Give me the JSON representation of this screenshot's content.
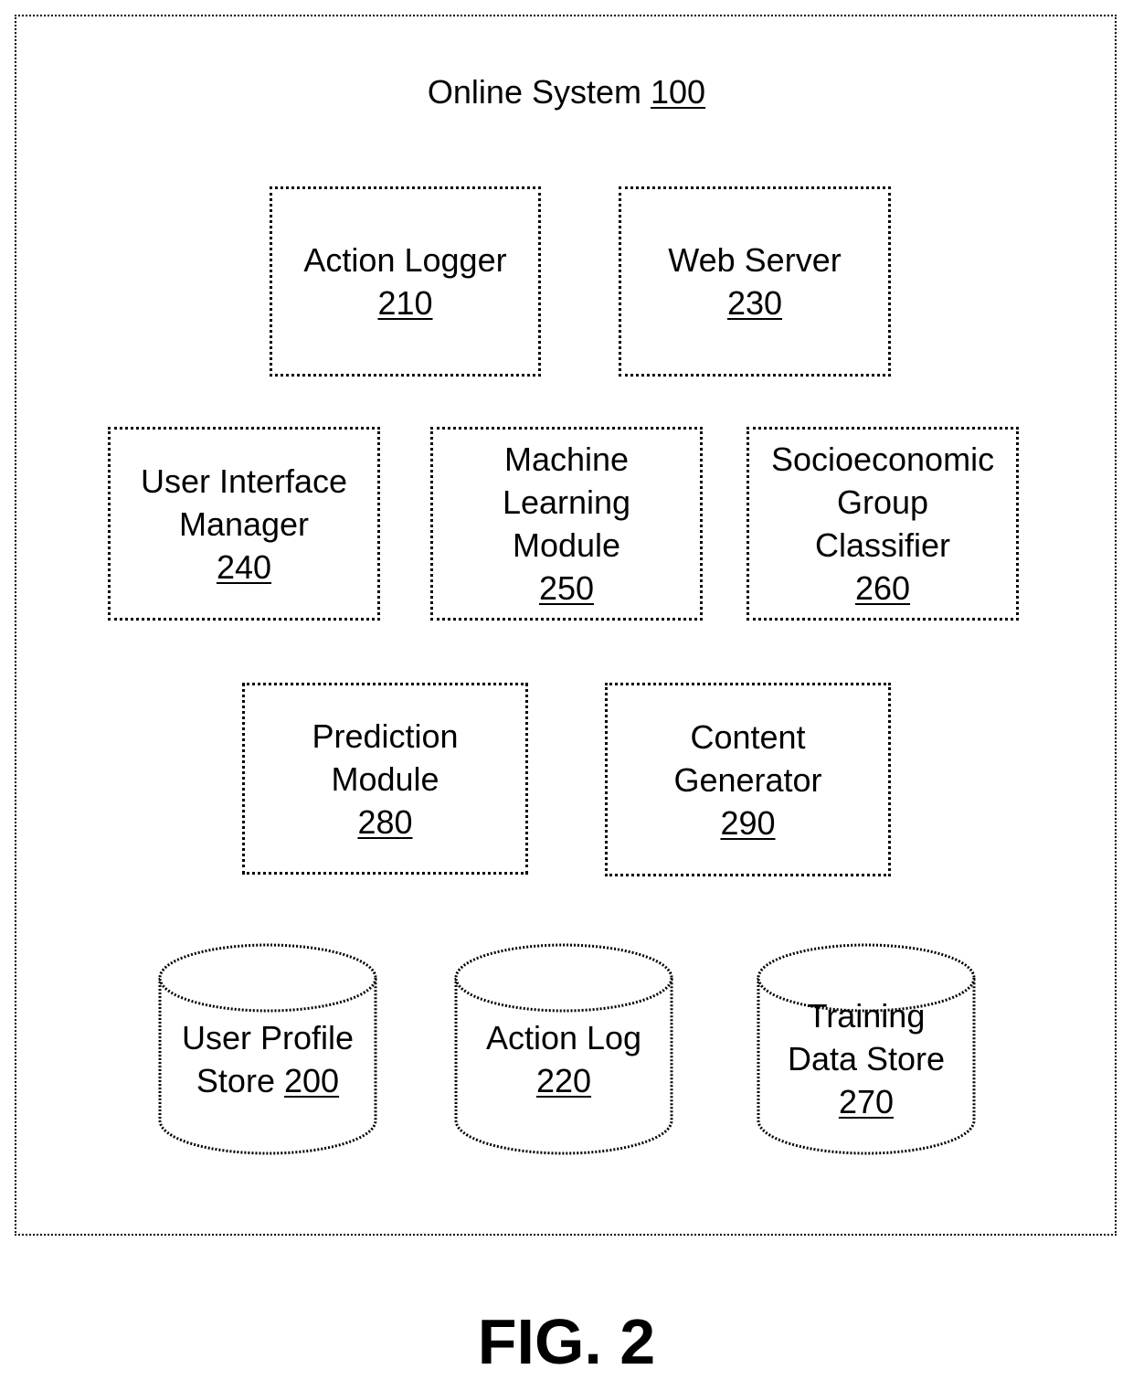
{
  "diagram": {
    "system": {
      "label": "Online System",
      "ref": "100"
    },
    "modules": [
      {
        "id": "action-logger",
        "lines": [
          "Action Logger"
        ],
        "ref": "210"
      },
      {
        "id": "web-server",
        "lines": [
          "Web Server"
        ],
        "ref": "230"
      },
      {
        "id": "user-interface-manager",
        "lines": [
          "User Interface",
          "Manager"
        ],
        "ref": "240"
      },
      {
        "id": "machine-learning-module",
        "lines": [
          "Machine",
          "Learning",
          "Module"
        ],
        "ref": "250"
      },
      {
        "id": "socioeconomic-group-classifier",
        "lines": [
          "Socioeconomic",
          "Group",
          "Classifier"
        ],
        "ref": "260"
      },
      {
        "id": "prediction-module",
        "lines": [
          "Prediction",
          "Module"
        ],
        "ref": "280"
      },
      {
        "id": "content-generator",
        "lines": [
          "Content",
          "Generator"
        ],
        "ref": "290"
      }
    ],
    "stores": [
      {
        "id": "user-profile-store",
        "lines": [
          "User Profile",
          "Store"
        ],
        "ref": "200",
        "ref_inline": true
      },
      {
        "id": "action-log",
        "lines": [
          "Action Log"
        ],
        "ref": "220",
        "ref_inline": false
      },
      {
        "id": "training-data-store",
        "lines": [
          "Training",
          "Data Store"
        ],
        "ref": "270",
        "ref_inline": false
      }
    ],
    "figure_label": "FIG. 2"
  }
}
